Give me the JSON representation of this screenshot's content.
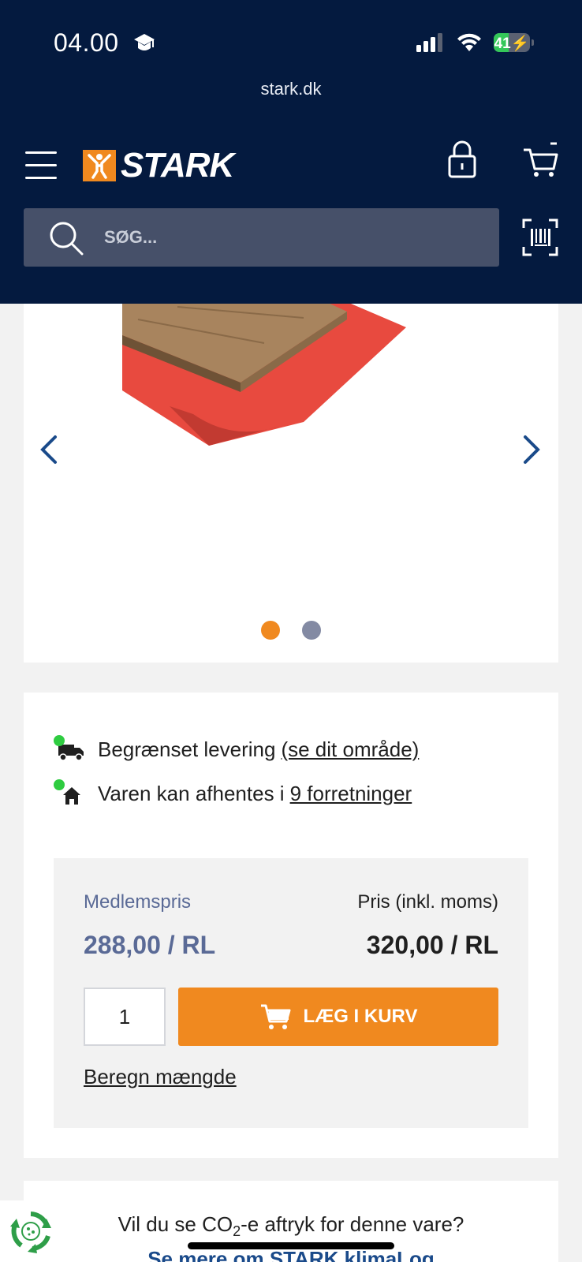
{
  "status_bar": {
    "time": "04.00",
    "battery": "41",
    "battery_level": 0.41,
    "icons": [
      "graduation-cap-icon",
      "cellular-signal-icon",
      "wifi-icon",
      "battery-charging-icon"
    ]
  },
  "browser": {
    "url": "stark.dk"
  },
  "header": {
    "logo_text": "STARK",
    "search_placeholder": "SØG...",
    "icons": [
      "menu-icon",
      "lock-icon",
      "cart-icon",
      "search-icon",
      "barcode-scan-icon"
    ]
  },
  "gallery": {
    "image_index": 1,
    "image_count": 2,
    "icons": [
      "chevron-left-icon",
      "chevron-right-icon"
    ]
  },
  "availability": {
    "delivery_text": "Begrænset levering",
    "delivery_link": "(se dit område)",
    "pickup_text": "Varen kan afhentes i",
    "pickup_link": "9 forretninger"
  },
  "pricing": {
    "member_label": "Medlemspris",
    "member_price": "288,00 / RL",
    "price_label": "Pris (inkl. moms)",
    "price_value": "320,00 / RL",
    "quantity": "1",
    "add_to_cart_label": "LÆG I KURV",
    "calculate_link": "Beregn mængde"
  },
  "co2": {
    "question_prefix": "Vil du se CO",
    "question_sub": "2",
    "question_suffix": "-e aftryk for denne vare?",
    "link": "Se mere om STARK klimaLog"
  },
  "colors": {
    "header_bg": "#041a3f",
    "accent_orange": "#f0891f",
    "member_blue": "#5a6a96",
    "search_bg": "#465069",
    "availability_green": "#2ecc40"
  }
}
